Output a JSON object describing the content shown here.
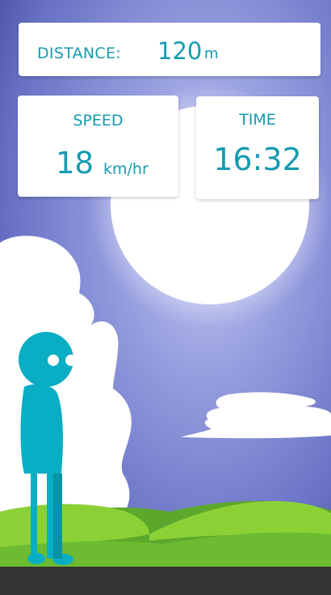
{
  "hud": {
    "distance": {
      "label": "DISTANCE:",
      "value": "120",
      "unit": "m"
    },
    "speed": {
      "label": "SPEED",
      "value": "18",
      "unit": "km/hr"
    },
    "time": {
      "label": "TIME",
      "value": "16:32"
    }
  },
  "colors": {
    "sky_top": "#3f4a9a",
    "sky_mid": "#8e95d9",
    "sun": "#ffffff",
    "cloud": "#ffffff",
    "hill_light": "#8fd13a",
    "hill_dark": "#5aa82a",
    "ground": "#333333",
    "character": "#0aaec4",
    "text_accent": "#169bb0"
  }
}
